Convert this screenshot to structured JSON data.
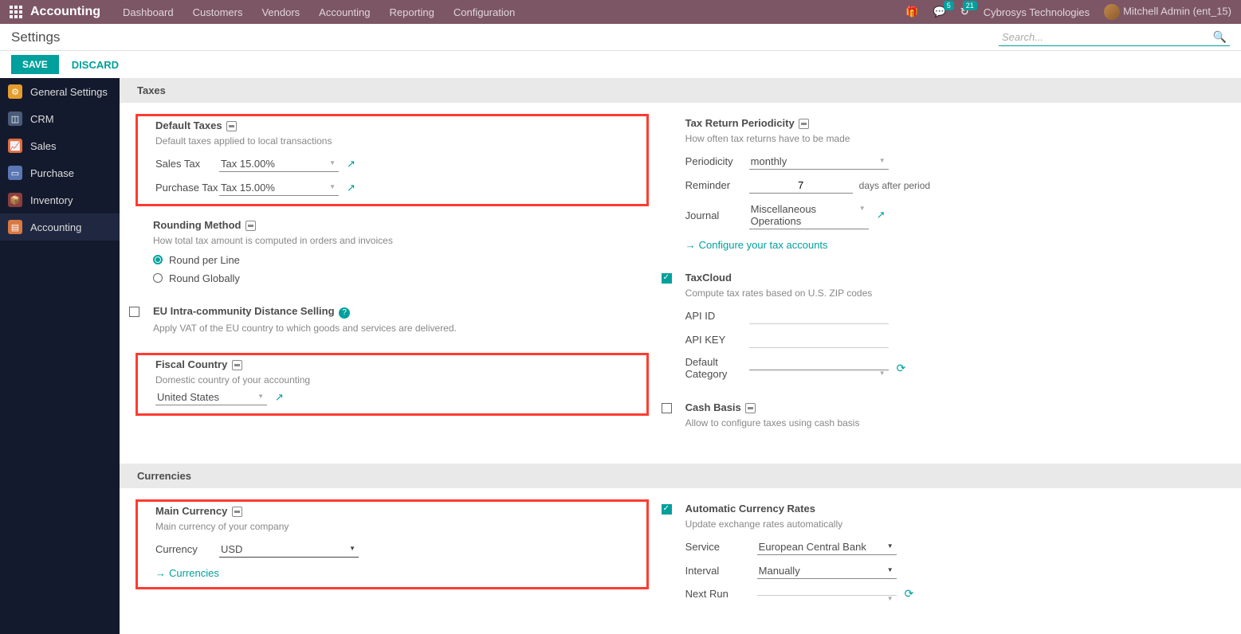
{
  "nav": {
    "app": "Accounting",
    "items": [
      "Dashboard",
      "Customers",
      "Vendors",
      "Accounting",
      "Reporting",
      "Configuration"
    ],
    "msg_badge": "5",
    "activity_badge": "21",
    "company": "Cybrosys Technologies",
    "user": "Mitchell Admin (ent_15)"
  },
  "subhead": {
    "title": "Settings",
    "search_ph": "Search..."
  },
  "actions": {
    "save": "SAVE",
    "discard": "DISCARD"
  },
  "sidebar": {
    "items": [
      {
        "label": "General Settings"
      },
      {
        "label": "CRM"
      },
      {
        "label": "Sales"
      },
      {
        "label": "Purchase"
      },
      {
        "label": "Inventory"
      },
      {
        "label": "Accounting"
      }
    ]
  },
  "sections": {
    "taxes": {
      "title": "Taxes",
      "default_taxes": {
        "title": "Default Taxes",
        "desc": "Default taxes applied to local transactions",
        "sales_label": "Sales Tax",
        "sales_val": "Tax 15.00%",
        "purchase_label": "Purchase Tax",
        "purchase_val": "Tax 15.00%"
      },
      "periodicity": {
        "title": "Tax Return Periodicity",
        "desc": "How often tax returns have to be made",
        "period_label": "Periodicity",
        "period_val": "monthly",
        "reminder_label": "Reminder",
        "reminder_val": "7",
        "reminder_suffix": "days after period",
        "journal_label": "Journal",
        "journal_val": "Miscellaneous Operations",
        "link": "Configure your tax accounts"
      },
      "rounding": {
        "title": "Rounding Method",
        "desc": "How total tax amount is computed in orders and invoices",
        "opt1": "Round per Line",
        "opt2": "Round Globally"
      },
      "taxcloud": {
        "title": "TaxCloud",
        "desc": "Compute tax rates based on U.S. ZIP codes",
        "api_id": "API ID",
        "api_key": "API KEY",
        "cat_label": "Default Category"
      },
      "eu": {
        "title": "EU Intra-community Distance Selling",
        "desc": "Apply VAT of the EU country to which goods and services are delivered."
      },
      "cash_basis": {
        "title": "Cash Basis",
        "desc": "Allow to configure taxes using cash basis"
      },
      "fiscal": {
        "title": "Fiscal Country",
        "desc": "Domestic country of your accounting",
        "val": "United States"
      }
    },
    "currencies": {
      "title": "Currencies",
      "main": {
        "title": "Main Currency",
        "desc": "Main currency of your company",
        "label": "Currency",
        "val": "USD",
        "link": "Currencies"
      },
      "auto": {
        "title": "Automatic Currency Rates",
        "desc": "Update exchange rates automatically",
        "service_label": "Service",
        "service_val": "European Central Bank",
        "interval_label": "Interval",
        "interval_val": "Manually",
        "next_label": "Next Run"
      }
    }
  }
}
